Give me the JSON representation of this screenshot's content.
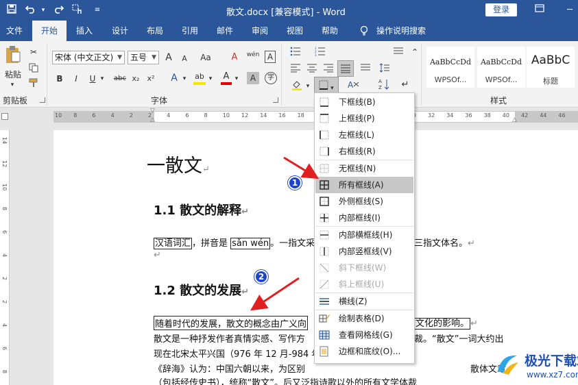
{
  "titlebar": {
    "title": "散文.docx [兼容模式] - Word",
    "login": "登录",
    "quick_access": [
      "save-icon",
      "undo-icon",
      "redo-icon",
      "touch-mode-icon",
      "customize-icon"
    ]
  },
  "tabs": [
    "文件",
    "开始",
    "插入",
    "设计",
    "布局",
    "引用",
    "邮件",
    "审阅",
    "视图",
    "帮助",
    "操作说明搜索"
  ],
  "ribbon": {
    "paste": "粘贴",
    "clipboard": "剪贴板",
    "font_name": "宋体 (中文正文)",
    "font_size": "五号",
    "font_group": "字体",
    "styles_group": "样式",
    "style_sample_1": "AaBbCcDd",
    "style_sample_2": "AaBbCcDd",
    "style_sample_3": "AaBbC",
    "style_name_1": "WPSOf...",
    "style_name_2": "WPSOf...",
    "style_name_3": "标题",
    "bold": "B",
    "italic": "I",
    "underline": "U",
    "strike": "abc",
    "sub": "x₂",
    "sup": "x²",
    "grow": "A",
    "shrink": "A",
    "clear": "A",
    "phonetic": "wén",
    "char_border": "A",
    "text_effect": "A",
    "highlight": "ab",
    "font_color": "A",
    "char_shade": "A",
    "aa": "Aa"
  },
  "ruler": {
    "h_labels": [
      "10",
      "8",
      "6",
      "4",
      "2",
      "2",
      "4",
      "6",
      "8",
      "10",
      "12",
      "14",
      "16",
      "18",
      "20",
      "22",
      "24",
      "26",
      "28",
      "30",
      "32",
      "34",
      "36",
      "38",
      "40",
      "42",
      "44",
      "46"
    ],
    "v_labels": [
      "14",
      "12",
      "10",
      "8",
      "6",
      "4",
      "2",
      "2",
      "4",
      "6",
      "8"
    ]
  },
  "document": {
    "h1": "一散文",
    "h2a": "1.1 散文的解释",
    "p1_box1": "汉语词汇",
    "p1_mid": "，拼音是 ",
    "p1_box2": "sǎn wén",
    "p1_tail": "。一指文采",
    "p1_end": "三指文体名。",
    "h2b": "1.2 散文的发展",
    "p2_start": "随着时代的发展，散文的概念由广义向",
    "p2_end": "文化的影响。",
    "p3_a": "散文是一种抒发作者真情实感、写作方",
    "p3_b": "裁。“散文”一词大约出",
    "p4": "现在北宋太平兴国（976 年 12 月-984 年",
    "p5_a": "《辞海》认为：中国六朝以来，为区别",
    "p5_b": "散体文章",
    "p6": "（包括经传史书），统称“散文”。后又泛指诗歌以外的所有文学体裁"
  },
  "border_menu": {
    "items": [
      {
        "label": "下框线(B)",
        "icon": "bottom-border-icon"
      },
      {
        "label": "上框线(P)",
        "icon": "top-border-icon"
      },
      {
        "label": "左框线(L)",
        "icon": "left-border-icon"
      },
      {
        "label": "右框线(R)",
        "icon": "right-border-icon"
      },
      {
        "label": "无框线(N)",
        "icon": "no-border-icon"
      },
      {
        "label": "所有框线(A)",
        "icon": "all-borders-icon"
      },
      {
        "label": "外侧框线(S)",
        "icon": "outside-borders-icon"
      },
      {
        "label": "内部框线(I)",
        "icon": "inside-borders-icon"
      },
      {
        "label": "内部横框线(H)",
        "icon": "inside-horizontal-border-icon"
      },
      {
        "label": "内部竖框线(V)",
        "icon": "inside-vertical-border-icon"
      },
      {
        "label": "斜下框线(W)",
        "icon": "diagonal-down-border-icon"
      },
      {
        "label": "斜上框线(U)",
        "icon": "diagonal-up-border-icon"
      },
      {
        "label": "横线(Z)",
        "icon": "horizontal-line-icon"
      },
      {
        "label": "绘制表格(D)",
        "icon": "draw-table-icon"
      },
      {
        "label": "查看网格线(G)",
        "icon": "view-gridlines-icon"
      },
      {
        "label": "边框和底纹(O)...",
        "icon": "borders-shading-icon"
      }
    ]
  },
  "annotations": {
    "badge1": "1",
    "badge2": "2"
  },
  "watermark": {
    "name": "极光下载站",
    "url": "www.xz7.com"
  },
  "colors": {
    "word_blue": "#2b579a",
    "annotation_red": "#e02020",
    "badge_blue": "#1f44c9"
  }
}
